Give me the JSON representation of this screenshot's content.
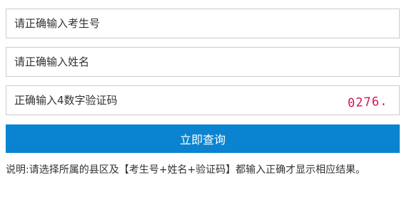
{
  "form": {
    "exam_number_placeholder": "请正确输入考生号",
    "name_placeholder": "请正确输入姓名",
    "captcha_placeholder": "正确输入4数字验证码",
    "captcha_code": "0276.",
    "submit_label": "立即查询",
    "note": "说明:请选择所属的县区及【考生号+姓名+验证码】都输入正确才显示相应结果。"
  },
  "colors": {
    "button_bg": "#0a84d0",
    "captcha_text": "#d6154f",
    "border": "#cccccc"
  }
}
